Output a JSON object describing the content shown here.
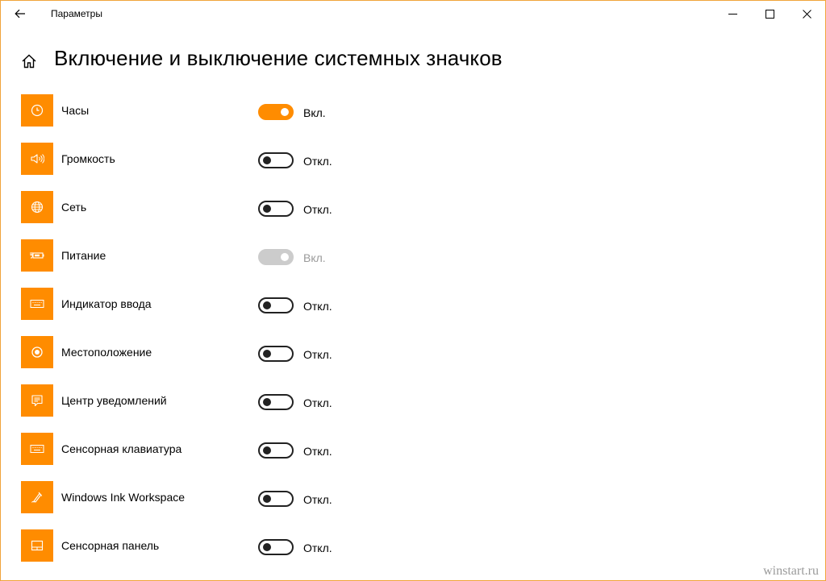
{
  "window": {
    "title": "Параметры",
    "accent_color": "#ff8c00"
  },
  "header": {
    "title": "Включение и выключение системных значков"
  },
  "items": [
    {
      "label": "Часы",
      "icon": "clock-icon",
      "state": "Вкл.",
      "on": true,
      "disabled": false
    },
    {
      "label": "Громкость",
      "icon": "volume-icon",
      "state": "Откл.",
      "on": false,
      "disabled": false
    },
    {
      "label": "Сеть",
      "icon": "globe-icon",
      "state": "Откл.",
      "on": false,
      "disabled": false
    },
    {
      "label": "Питание",
      "icon": "battery-icon",
      "state": "Вкл.",
      "on": true,
      "disabled": true
    },
    {
      "label": "Индикатор ввода",
      "icon": "keyboard-icon",
      "state": "Откл.",
      "on": false,
      "disabled": false
    },
    {
      "label": "Местоположение",
      "icon": "location-icon",
      "state": "Откл.",
      "on": false,
      "disabled": false
    },
    {
      "label": "Центр уведомлений",
      "icon": "action-center-icon",
      "state": "Откл.",
      "on": false,
      "disabled": false
    },
    {
      "label": "Сенсорная клавиатура",
      "icon": "touch-keyboard-icon",
      "state": "Откл.",
      "on": false,
      "disabled": false
    },
    {
      "label": "Windows Ink Workspace",
      "icon": "pen-icon",
      "state": "Откл.",
      "on": false,
      "disabled": false
    },
    {
      "label": "Сенсорная панель",
      "icon": "touchpad-icon",
      "state": "Откл.",
      "on": false,
      "disabled": false
    }
  ],
  "watermark": "winstart.ru"
}
